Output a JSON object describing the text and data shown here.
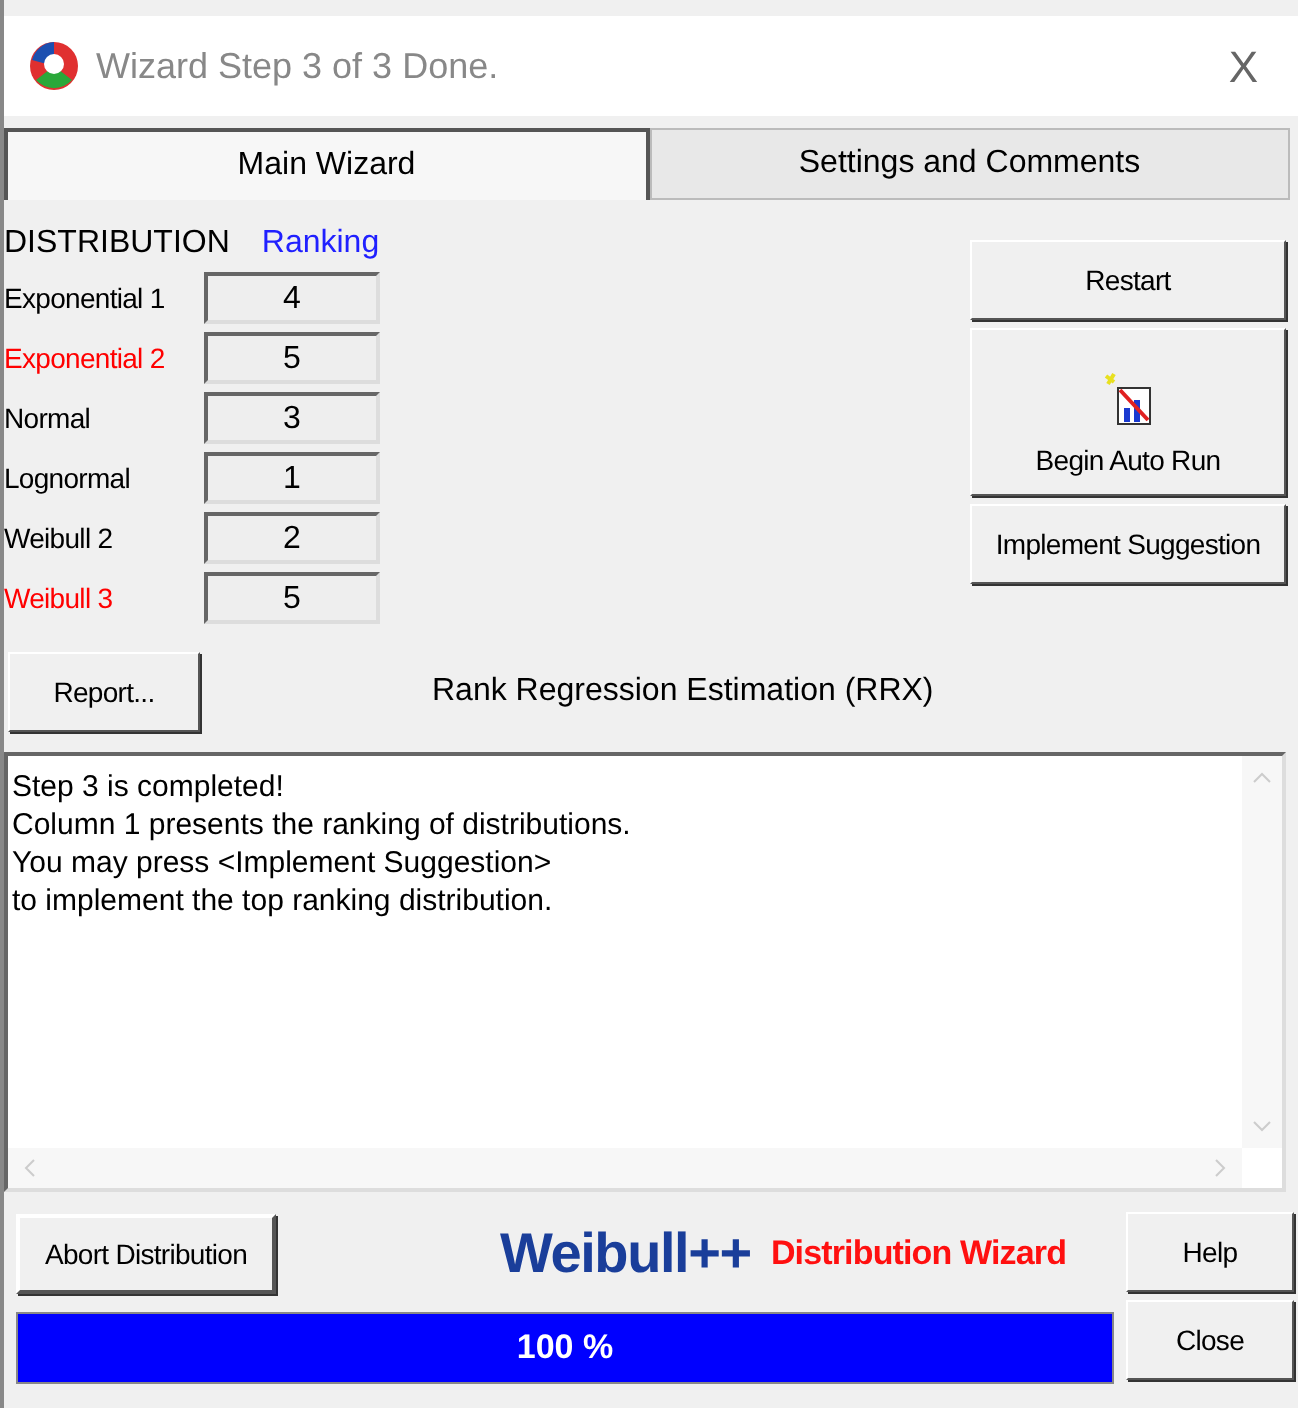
{
  "window": {
    "title": "Wizard Step 3 of 3 Done.",
    "close": "X"
  },
  "tabs": [
    {
      "label": "Main Wizard",
      "selected": true
    },
    {
      "label": "Settings and Comments",
      "selected": false
    }
  ],
  "distribution_header": "DISTRIBUTION",
  "ranking_header": "Ranking",
  "distributions": [
    {
      "name": "Exponential 1",
      "color": "#000000",
      "rank": "4"
    },
    {
      "name": "Exponential 2",
      "color": "#ff0000",
      "rank": "5"
    },
    {
      "name": "Normal",
      "color": "#000000",
      "rank": "3"
    },
    {
      "name": "Lognormal",
      "color": "#000000",
      "rank": "1"
    },
    {
      "name": "Weibull 2",
      "color": "#000000",
      "rank": "2"
    },
    {
      "name": "Weibull 3",
      "color": "#ff0000",
      "rank": "5"
    }
  ],
  "side_buttons": [
    {
      "kind": "text",
      "label": "Restart"
    },
    {
      "kind": "icon",
      "label": "Begin Auto Run"
    },
    {
      "kind": "text",
      "label": "Implement Suggestion"
    }
  ],
  "report_button": "Report...",
  "method": "Rank Regression Estimation (RRX)",
  "messages": [
    "Step 3 is completed!",
    "Column 1 presents the ranking of distributions.",
    "You may press <Implement Suggestion>",
    "to implement the top ranking distribution."
  ],
  "abort_button": "Abort Distribution",
  "logo": "Weibull++",
  "logo_subtitle": "Distribution Wizard",
  "help_button": "Help",
  "close_button": "Close",
  "progress": {
    "level": 1,
    "reading": "100 %"
  }
}
